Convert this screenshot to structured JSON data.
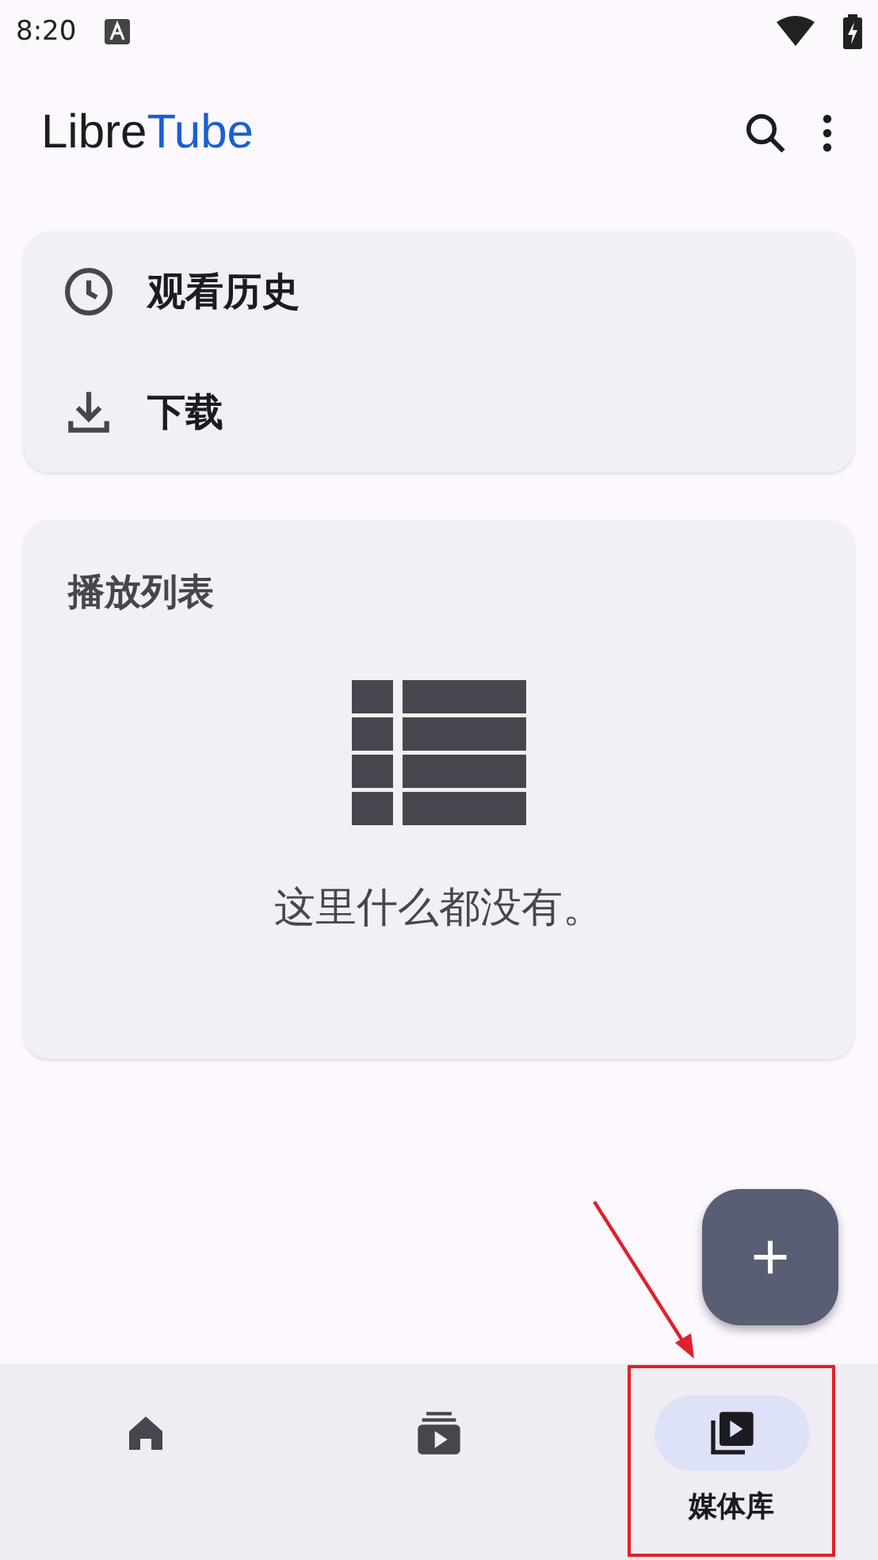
{
  "status_bar": {
    "time": "8:20"
  },
  "app_bar": {
    "title_first": "Libre",
    "title_second": "Tube"
  },
  "shortcuts": [
    {
      "kind": "history",
      "label": "观看历史"
    },
    {
      "kind": "download",
      "label": "下载"
    }
  ],
  "playlists": {
    "title": "播放列表",
    "empty_message": "这里什么都没有。"
  },
  "fab": {
    "label": "+"
  },
  "bottom_nav": [
    {
      "kind": "home",
      "selected": false
    },
    {
      "kind": "subscriptions",
      "selected": false
    },
    {
      "kind": "library",
      "selected": true,
      "label": "媒体库"
    }
  ]
}
